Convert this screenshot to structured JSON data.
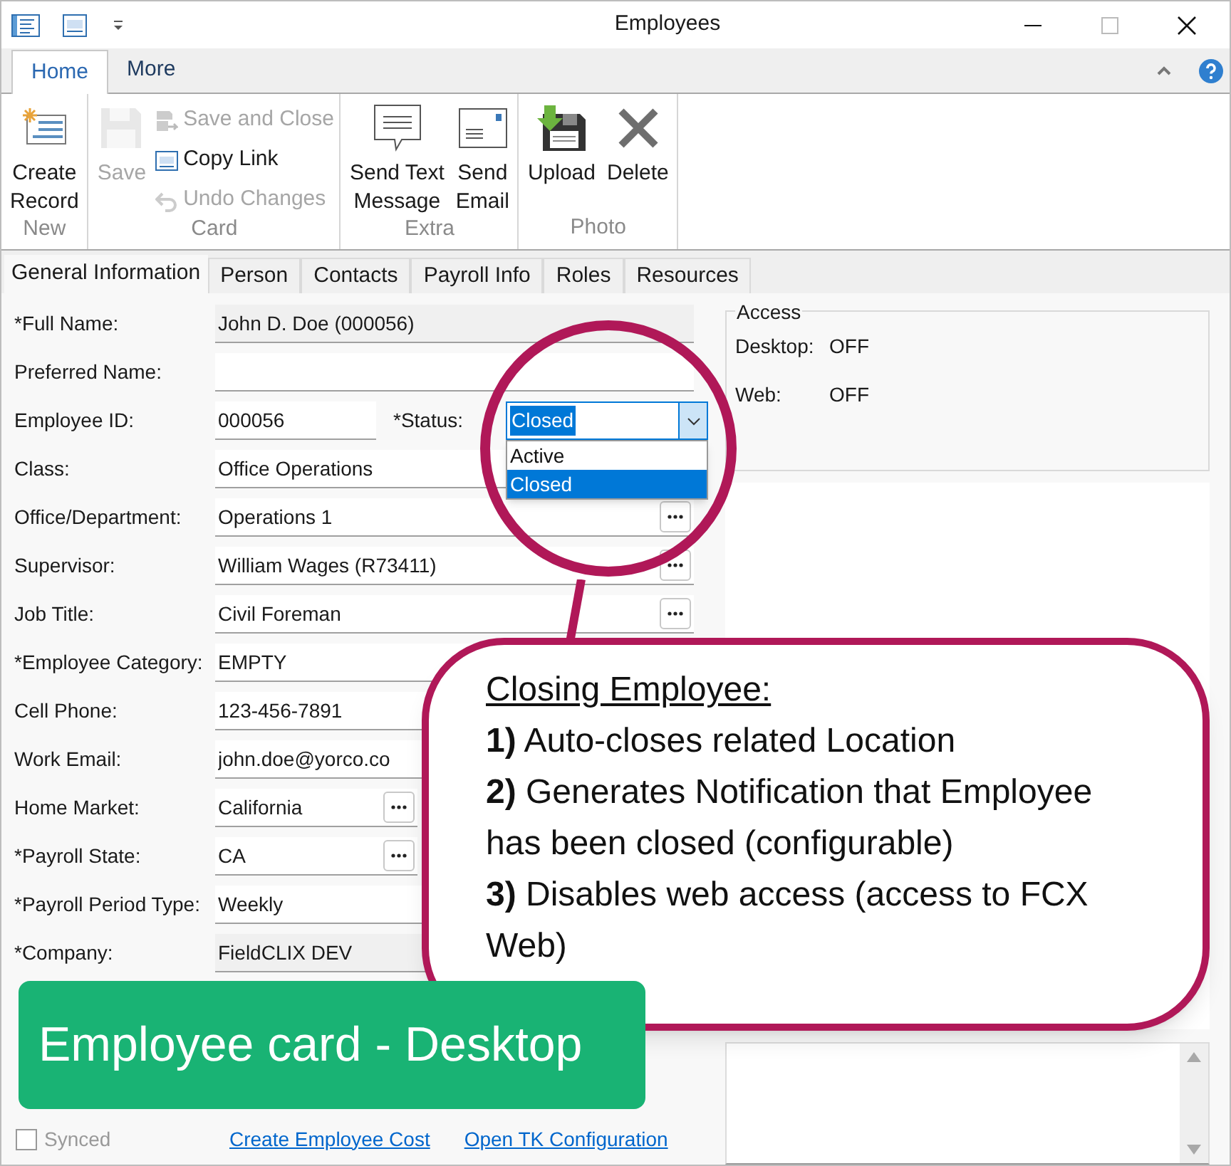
{
  "window": {
    "title": "Employees"
  },
  "ribbon_tabs": [
    {
      "label": "Home",
      "selected": true
    },
    {
      "label": "More",
      "selected": false
    }
  ],
  "ribbon_groups": [
    {
      "label": "New",
      "commands": [
        {
          "label": "Create\nRecord",
          "kind": "large",
          "disabled": false
        }
      ]
    },
    {
      "label": "Card",
      "commands": [
        {
          "label": "Save",
          "kind": "large",
          "disabled": true
        },
        {
          "label": "Save and Close",
          "kind": "small",
          "disabled": true
        },
        {
          "label": "Copy Link",
          "kind": "small",
          "disabled": false
        },
        {
          "label": "Undo Changes",
          "kind": "small",
          "disabled": true
        }
      ]
    },
    {
      "label": "Extra",
      "commands": [
        {
          "label": "Send Text\nMessage",
          "kind": "large",
          "disabled": false
        },
        {
          "label": "Send\nEmail",
          "kind": "large",
          "disabled": false
        }
      ]
    },
    {
      "label": "Photo",
      "commands": [
        {
          "label": "Upload",
          "kind": "large",
          "disabled": false
        },
        {
          "label": "Delete",
          "kind": "large",
          "disabled": false
        }
      ]
    }
  ],
  "doc_tabs": [
    {
      "label": "General Information",
      "selected": true
    },
    {
      "label": "Person",
      "selected": false
    },
    {
      "label": "Contacts",
      "selected": false
    },
    {
      "label": "Payroll Info",
      "selected": false
    },
    {
      "label": "Roles",
      "selected": false
    },
    {
      "label": "Resources",
      "selected": false
    }
  ],
  "fields": [
    {
      "label": "*Full Name:",
      "value": "John D. Doe (000056)",
      "kind": "readonly"
    },
    {
      "label": "Preferred Name:",
      "kind": "text"
    },
    {
      "label": "Employee ID:",
      "value": "000056",
      "kind": "short"
    },
    {
      "label": "Class:",
      "value": "Office Operations",
      "kind": "text"
    },
    {
      "label": "Office/Department:",
      "value": "Operations 1",
      "kind": "lookup"
    },
    {
      "label": "Supervisor:",
      "value": "William Wages (R73411)",
      "kind": "lookup"
    },
    {
      "label": "Job Title:",
      "value": "Civil Foreman",
      "kind": "lookup"
    },
    {
      "label": "*Employee Category:",
      "value": "EMPTY",
      "kind": "text"
    },
    {
      "label": "Cell Phone:",
      "value": "123-456-7891",
      "kind": "text"
    },
    {
      "label": "Work Email:",
      "value": "john.doe@yorco.co",
      "kind": "text"
    },
    {
      "label": "Home Market:",
      "value": "California",
      "kind": "short_lookup"
    },
    {
      "label": "*Payroll State:",
      "value": "CA",
      "kind": "short_lookup"
    },
    {
      "label": "*Payroll Period Type:",
      "value": "Weekly",
      "kind": "text"
    },
    {
      "label": "*Company:",
      "value": "FieldCLIX DEV",
      "kind": "readonly"
    }
  ],
  "status": {
    "label": "*Status:",
    "value": "Closed",
    "expanded": true,
    "options": [
      {
        "label": "Active",
        "selected": false
      },
      {
        "label": "Closed",
        "selected": true
      }
    ]
  },
  "access": {
    "title": "Access",
    "rows": [
      {
        "label": "Desktop:",
        "value": "OFF"
      },
      {
        "label": "Web:",
        "value": "OFF"
      }
    ]
  },
  "footer": {
    "synced": {
      "label": "Synced",
      "checked": false
    },
    "links": [
      "Create Employee Cost",
      "Open TK Configuration"
    ]
  },
  "callout": {
    "title": "Closing Employee:",
    "items": [
      {
        "number": "1)",
        "text": "Auto-closes related Location"
      },
      {
        "number": "2)",
        "text": "Generates Notification that Employee has been closed (configurable)"
      },
      {
        "number": "3)",
        "text": "Disables web access (access to FCX Web)"
      }
    ]
  },
  "banner": {
    "text": "Employee card - Desktop"
  }
}
